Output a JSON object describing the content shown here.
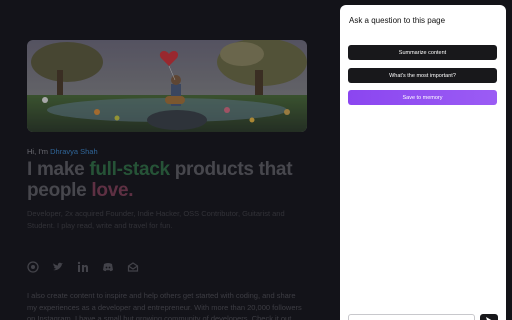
{
  "site": {
    "greeting_prefix": "Hi, I'm",
    "greeting_name": "Dhravya Shah",
    "headline_part1": "I make ",
    "headline_highlight": "full-stack",
    "headline_part2": " products that people ",
    "headline_love": "love.",
    "bio": "Developer, 2x acquired Founder, Indie Hacker, OSS Contributor, Guitarist and Student. I play read, write and travel for fun.",
    "socials": [
      "github-icon",
      "twitter-icon",
      "linkedin-icon",
      "discord-icon",
      "mail-icon"
    ],
    "about": "I also create content to inspire and help others get started with coding, and share my experiences as a developer and entrepreneur. With more than 20,000 followers on Instagram, I have a small but growing community of developers. Check it out"
  },
  "panel": {
    "title": "Ask a question to this page",
    "buttons": [
      {
        "label": "Summarize content",
        "style": "dark"
      },
      {
        "label": "What's the most important?",
        "style": "dark"
      },
      {
        "label": "Save to memory",
        "style": "purple"
      }
    ],
    "input_placeholder": "",
    "send_icon": "send-icon"
  },
  "colors": {
    "page_bg": "#16161c",
    "panel_bg": "#ffffff",
    "button_dark": "#18181b",
    "button_purple": "#8b46f0",
    "name_link": "#3b82c4",
    "highlight_green": "#2f6b45",
    "highlight_love": "#7a3d55"
  }
}
